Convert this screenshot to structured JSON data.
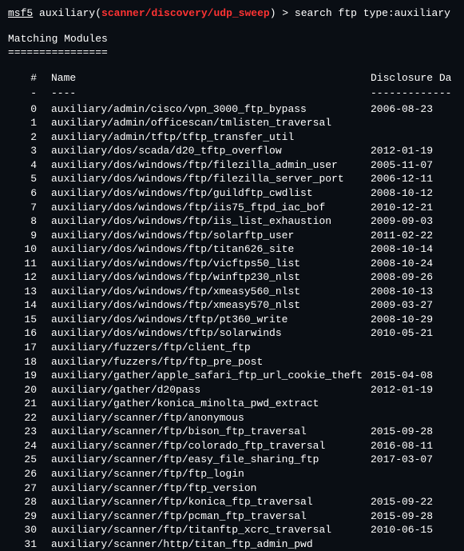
{
  "prompt": {
    "prefix": "msf5",
    "aux_label": " auxiliary(",
    "module_path": "scanner/discovery/udp_sweep",
    "suffix": ") > ",
    "command": "search ftp type:auxiliary"
  },
  "section": {
    "title": "Matching Modules",
    "bar": "================"
  },
  "headers": {
    "idx": "#",
    "name": "Name",
    "date": "Disclosure Da"
  },
  "dashes": {
    "idx": "-",
    "name": "----",
    "date": "-------------"
  },
  "rows": [
    {
      "idx": "0",
      "name": "auxiliary/admin/cisco/vpn_3000_ftp_bypass",
      "date": "2006-08-23"
    },
    {
      "idx": "1",
      "name": "auxiliary/admin/officescan/tmlisten_traversal",
      "date": ""
    },
    {
      "idx": "2",
      "name": "auxiliary/admin/tftp/tftp_transfer_util",
      "date": ""
    },
    {
      "idx": "3",
      "name": "auxiliary/dos/scada/d20_tftp_overflow",
      "date": "2012-01-19"
    },
    {
      "idx": "4",
      "name": "auxiliary/dos/windows/ftp/filezilla_admin_user",
      "date": "2005-11-07"
    },
    {
      "idx": "5",
      "name": "auxiliary/dos/windows/ftp/filezilla_server_port",
      "date": "2006-12-11"
    },
    {
      "idx": "6",
      "name": "auxiliary/dos/windows/ftp/guildftp_cwdlist",
      "date": "2008-10-12"
    },
    {
      "idx": "7",
      "name": "auxiliary/dos/windows/ftp/iis75_ftpd_iac_bof",
      "date": "2010-12-21"
    },
    {
      "idx": "8",
      "name": "auxiliary/dos/windows/ftp/iis_list_exhaustion",
      "date": "2009-09-03"
    },
    {
      "idx": "9",
      "name": "auxiliary/dos/windows/ftp/solarftp_user",
      "date": "2011-02-22"
    },
    {
      "idx": "10",
      "name": "auxiliary/dos/windows/ftp/titan626_site",
      "date": "2008-10-14"
    },
    {
      "idx": "11",
      "name": "auxiliary/dos/windows/ftp/vicftps50_list",
      "date": "2008-10-24"
    },
    {
      "idx": "12",
      "name": "auxiliary/dos/windows/ftp/winftp230_nlst",
      "date": "2008-09-26"
    },
    {
      "idx": "13",
      "name": "auxiliary/dos/windows/ftp/xmeasy560_nlst",
      "date": "2008-10-13"
    },
    {
      "idx": "14",
      "name": "auxiliary/dos/windows/ftp/xmeasy570_nlst",
      "date": "2009-03-27"
    },
    {
      "idx": "15",
      "name": "auxiliary/dos/windows/tftp/pt360_write",
      "date": "2008-10-29"
    },
    {
      "idx": "16",
      "name": "auxiliary/dos/windows/tftp/solarwinds",
      "date": "2010-05-21"
    },
    {
      "idx": "17",
      "name": "auxiliary/fuzzers/ftp/client_ftp",
      "date": ""
    },
    {
      "idx": "18",
      "name": "auxiliary/fuzzers/ftp/ftp_pre_post",
      "date": ""
    },
    {
      "idx": "19",
      "name": "auxiliary/gather/apple_safari_ftp_url_cookie_theft",
      "date": "2015-04-08"
    },
    {
      "idx": "20",
      "name": "auxiliary/gather/d20pass",
      "date": "2012-01-19"
    },
    {
      "idx": "21",
      "name": "auxiliary/gather/konica_minolta_pwd_extract",
      "date": ""
    },
    {
      "idx": "22",
      "name": "auxiliary/scanner/ftp/anonymous",
      "date": ""
    },
    {
      "idx": "23",
      "name": "auxiliary/scanner/ftp/bison_ftp_traversal",
      "date": "2015-09-28"
    },
    {
      "idx": "24",
      "name": "auxiliary/scanner/ftp/colorado_ftp_traversal",
      "date": "2016-08-11"
    },
    {
      "idx": "25",
      "name": "auxiliary/scanner/ftp/easy_file_sharing_ftp",
      "date": "2017-03-07"
    },
    {
      "idx": "26",
      "name": "auxiliary/scanner/ftp/ftp_login",
      "date": ""
    },
    {
      "idx": "27",
      "name": "auxiliary/scanner/ftp/ftp_version",
      "date": ""
    },
    {
      "idx": "28",
      "name": "auxiliary/scanner/ftp/konica_ftp_traversal",
      "date": "2015-09-22"
    },
    {
      "idx": "29",
      "name": "auxiliary/scanner/ftp/pcman_ftp_traversal",
      "date": "2015-09-28"
    },
    {
      "idx": "30",
      "name": "auxiliary/scanner/ftp/titanftp_xcrc_traversal",
      "date": "2010-06-15"
    },
    {
      "idx": "31",
      "name": "auxiliary/scanner/http/titan_ftp_admin_pwd",
      "date": ""
    }
  ]
}
